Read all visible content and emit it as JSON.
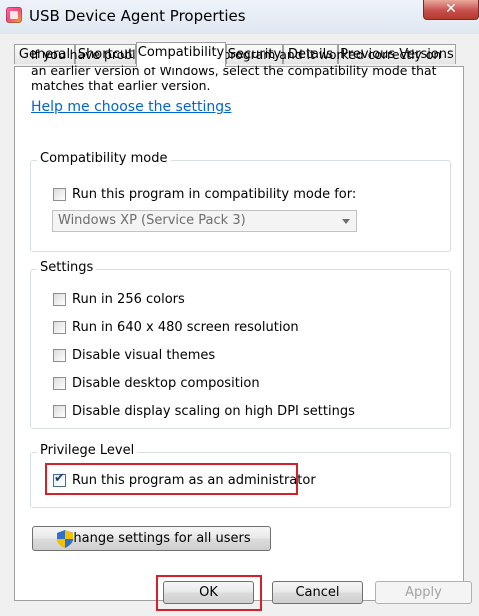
{
  "window": {
    "title": "USB Device Agent Properties",
    "close_glyph": "✕",
    "icon": "app-icon"
  },
  "tabs": [
    {
      "label": "General"
    },
    {
      "label": "Shortcut"
    },
    {
      "label": "Compatibility",
      "active": true
    },
    {
      "label": "Security"
    },
    {
      "label": "Details"
    },
    {
      "label": "Previous Versions"
    }
  ],
  "intro_text": "If you have problems with this program and it worked correctly on an earlier version of Windows, select the compatibility mode that matches that earlier version.",
  "help_link": "Help me choose the settings",
  "compat_mode": {
    "group_label": "Compatibility mode",
    "checkbox_label": "Run this program in compatibility mode for:",
    "checked": false,
    "select_value": "Windows XP (Service Pack 3)"
  },
  "settings": {
    "group_label": "Settings",
    "options": [
      {
        "label": "Run in 256 colors",
        "checked": false
      },
      {
        "label": "Run in 640 x 480 screen resolution",
        "checked": false
      },
      {
        "label": "Disable visual themes",
        "checked": false
      },
      {
        "label": "Disable desktop composition",
        "checked": false
      },
      {
        "label": "Disable display scaling on high DPI settings",
        "checked": false
      }
    ]
  },
  "privilege": {
    "group_label": "Privilege Level",
    "checkbox_label": "Run this program as an administrator",
    "checked": true
  },
  "change_settings_button": {
    "label": "Change settings for all users",
    "icon": "uac-shield-icon"
  },
  "footer": {
    "ok_label": "OK",
    "cancel_label": "Cancel",
    "apply_label": "Apply",
    "apply_disabled": true
  },
  "colors": {
    "highlight_frame": "#d6212b",
    "link": "#0066cc",
    "dialog_bg": "#f0f0f0"
  }
}
